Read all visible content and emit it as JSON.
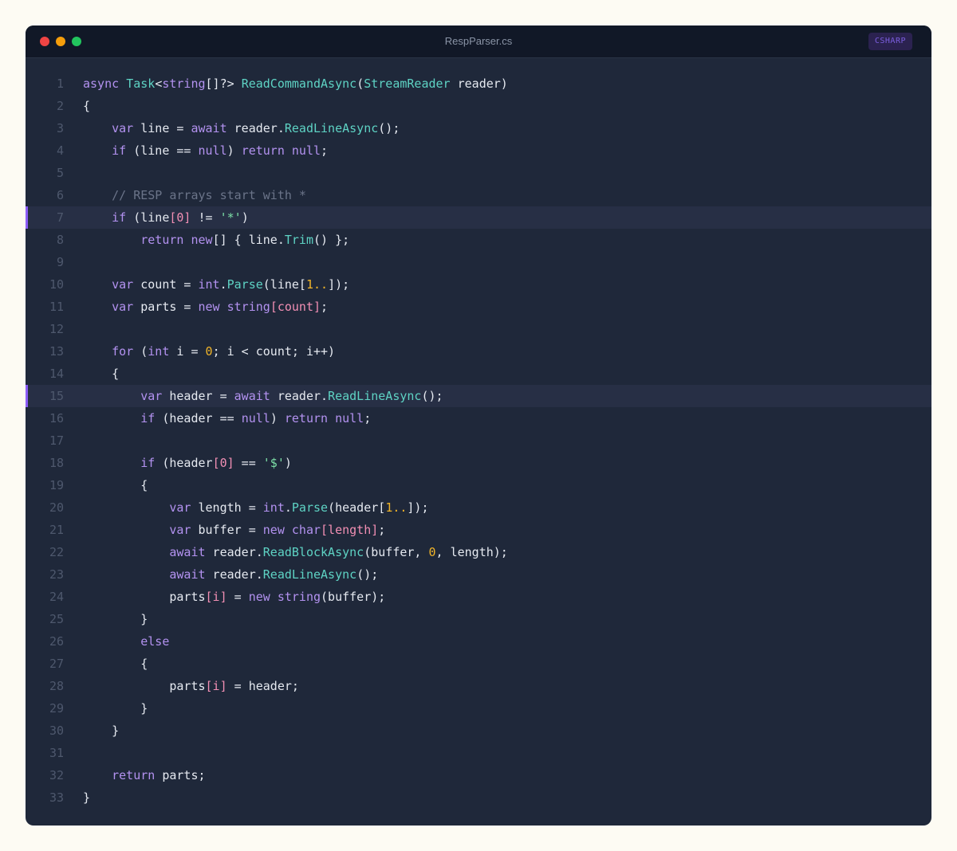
{
  "window": {
    "title": "RespParser.cs",
    "language_badge": "CSHARP"
  },
  "colors": {
    "page_background": "#fdfbf3",
    "editor_background": "#1f283a",
    "titlebar_background": "#111827",
    "highlight_background": "#272f45",
    "highlight_accent": "#8b5cf6",
    "keyword": "#b392f0",
    "function": "#5ed3c4",
    "number": "#f0b429",
    "string": "#7ee0a8",
    "index": "#f28fb4",
    "comment": "#6b7489"
  },
  "highlighted_lines": [
    7,
    15
  ],
  "lines": [
    {
      "n": "1",
      "t": [
        [
          "kw",
          "async "
        ],
        [
          "ty",
          "Task"
        ],
        [
          "pl",
          "<"
        ],
        [
          "kw",
          "string"
        ],
        [
          "pl",
          "[]?> "
        ],
        [
          "fn",
          "ReadCommandAsync"
        ],
        [
          "pl",
          "("
        ],
        [
          "ty",
          "StreamReader"
        ],
        [
          "pl",
          " reader)"
        ]
      ]
    },
    {
      "n": "2",
      "t": [
        [
          "pl",
          "{"
        ]
      ]
    },
    {
      "n": "3",
      "t": [
        [
          "pl",
          "    "
        ],
        [
          "kw",
          "var"
        ],
        [
          "pl",
          " line = "
        ],
        [
          "kw",
          "await"
        ],
        [
          "pl",
          " reader."
        ],
        [
          "fn",
          "ReadLineAsync"
        ],
        [
          "pl",
          "();"
        ]
      ]
    },
    {
      "n": "4",
      "t": [
        [
          "pl",
          "    "
        ],
        [
          "kw",
          "if"
        ],
        [
          "pl",
          " (line == "
        ],
        [
          "kw",
          "null"
        ],
        [
          "pl",
          ") "
        ],
        [
          "kw",
          "return"
        ],
        [
          "pl",
          " "
        ],
        [
          "kw",
          "null"
        ],
        [
          "pl",
          ";"
        ]
      ]
    },
    {
      "n": "5",
      "t": []
    },
    {
      "n": "6",
      "t": [
        [
          "pl",
          "    "
        ],
        [
          "cm",
          "// RESP arrays start with *"
        ]
      ]
    },
    {
      "n": "7",
      "t": [
        [
          "pl",
          "    "
        ],
        [
          "kw",
          "if"
        ],
        [
          "pl",
          " (line"
        ],
        [
          "idx",
          "[0]"
        ],
        [
          "pl",
          " != "
        ],
        [
          "str",
          "'*'"
        ],
        [
          "pl",
          ")"
        ]
      ]
    },
    {
      "n": "8",
      "t": [
        [
          "pl",
          "        "
        ],
        [
          "kw",
          "return"
        ],
        [
          "pl",
          " "
        ],
        [
          "kw",
          "new"
        ],
        [
          "pl",
          "[] { line."
        ],
        [
          "fn",
          "Trim"
        ],
        [
          "pl",
          "() };"
        ]
      ]
    },
    {
      "n": "9",
      "t": []
    },
    {
      "n": "10",
      "t": [
        [
          "pl",
          "    "
        ],
        [
          "kw",
          "var"
        ],
        [
          "pl",
          " count = "
        ],
        [
          "kw",
          "int"
        ],
        [
          "pl",
          "."
        ],
        [
          "fn",
          "Parse"
        ],
        [
          "pl",
          "(line["
        ],
        [
          "num",
          "1.."
        ],
        [
          "pl",
          "]);"
        ]
      ]
    },
    {
      "n": "11",
      "t": [
        [
          "pl",
          "    "
        ],
        [
          "kw",
          "var"
        ],
        [
          "pl",
          " parts = "
        ],
        [
          "kw",
          "new"
        ],
        [
          "pl",
          " "
        ],
        [
          "kw",
          "string"
        ],
        [
          "idx",
          "[count]"
        ],
        [
          "pl",
          ";"
        ]
      ]
    },
    {
      "n": "12",
      "t": []
    },
    {
      "n": "13",
      "t": [
        [
          "pl",
          "    "
        ],
        [
          "kw",
          "for"
        ],
        [
          "pl",
          " ("
        ],
        [
          "kw",
          "int"
        ],
        [
          "pl",
          " i = "
        ],
        [
          "num",
          "0"
        ],
        [
          "pl",
          "; i < count; i++)"
        ]
      ]
    },
    {
      "n": "14",
      "t": [
        [
          "pl",
          "    {"
        ]
      ]
    },
    {
      "n": "15",
      "t": [
        [
          "pl",
          "        "
        ],
        [
          "kw",
          "var"
        ],
        [
          "pl",
          " header = "
        ],
        [
          "kw",
          "await"
        ],
        [
          "pl",
          " reader."
        ],
        [
          "fn",
          "ReadLineAsync"
        ],
        [
          "pl",
          "();"
        ]
      ]
    },
    {
      "n": "16",
      "t": [
        [
          "pl",
          "        "
        ],
        [
          "kw",
          "if"
        ],
        [
          "pl",
          " (header == "
        ],
        [
          "kw",
          "null"
        ],
        [
          "pl",
          ") "
        ],
        [
          "kw",
          "return"
        ],
        [
          "pl",
          " "
        ],
        [
          "kw",
          "null"
        ],
        [
          "pl",
          ";"
        ]
      ]
    },
    {
      "n": "17",
      "t": []
    },
    {
      "n": "18",
      "t": [
        [
          "pl",
          "        "
        ],
        [
          "kw",
          "if"
        ],
        [
          "pl",
          " (header"
        ],
        [
          "idx",
          "[0]"
        ],
        [
          "pl",
          " == "
        ],
        [
          "str",
          "'$'"
        ],
        [
          "pl",
          ")"
        ]
      ]
    },
    {
      "n": "19",
      "t": [
        [
          "pl",
          "        {"
        ]
      ]
    },
    {
      "n": "20",
      "t": [
        [
          "pl",
          "            "
        ],
        [
          "kw",
          "var"
        ],
        [
          "pl",
          " length = "
        ],
        [
          "kw",
          "int"
        ],
        [
          "pl",
          "."
        ],
        [
          "fn",
          "Parse"
        ],
        [
          "pl",
          "(header["
        ],
        [
          "num",
          "1.."
        ],
        [
          "pl",
          "]);"
        ]
      ]
    },
    {
      "n": "21",
      "t": [
        [
          "pl",
          "            "
        ],
        [
          "kw",
          "var"
        ],
        [
          "pl",
          " buffer = "
        ],
        [
          "kw",
          "new"
        ],
        [
          "pl",
          " "
        ],
        [
          "kw",
          "char"
        ],
        [
          "idx",
          "[length]"
        ],
        [
          "pl",
          ";"
        ]
      ]
    },
    {
      "n": "22",
      "t": [
        [
          "pl",
          "            "
        ],
        [
          "kw",
          "await"
        ],
        [
          "pl",
          " reader."
        ],
        [
          "fn",
          "ReadBlockAsync"
        ],
        [
          "pl",
          "(buffer, "
        ],
        [
          "num",
          "0"
        ],
        [
          "pl",
          ", length);"
        ]
      ]
    },
    {
      "n": "23",
      "t": [
        [
          "pl",
          "            "
        ],
        [
          "kw",
          "await"
        ],
        [
          "pl",
          " reader."
        ],
        [
          "fn",
          "ReadLineAsync"
        ],
        [
          "pl",
          "();"
        ]
      ]
    },
    {
      "n": "24",
      "t": [
        [
          "pl",
          "            parts"
        ],
        [
          "idx",
          "[i]"
        ],
        [
          "pl",
          " = "
        ],
        [
          "kw",
          "new"
        ],
        [
          "pl",
          " "
        ],
        [
          "kw",
          "string"
        ],
        [
          "pl",
          "(buffer);"
        ]
      ]
    },
    {
      "n": "25",
      "t": [
        [
          "pl",
          "        }"
        ]
      ]
    },
    {
      "n": "26",
      "t": [
        [
          "pl",
          "        "
        ],
        [
          "kw",
          "else"
        ]
      ]
    },
    {
      "n": "27",
      "t": [
        [
          "pl",
          "        {"
        ]
      ]
    },
    {
      "n": "28",
      "t": [
        [
          "pl",
          "            parts"
        ],
        [
          "idx",
          "[i]"
        ],
        [
          "pl",
          " = header;"
        ]
      ]
    },
    {
      "n": "29",
      "t": [
        [
          "pl",
          "        }"
        ]
      ]
    },
    {
      "n": "30",
      "t": [
        [
          "pl",
          "    }"
        ]
      ]
    },
    {
      "n": "31",
      "t": []
    },
    {
      "n": "32",
      "t": [
        [
          "pl",
          "    "
        ],
        [
          "kw",
          "return"
        ],
        [
          "pl",
          " parts;"
        ]
      ]
    },
    {
      "n": "33",
      "t": [
        [
          "pl",
          "}"
        ]
      ]
    }
  ]
}
